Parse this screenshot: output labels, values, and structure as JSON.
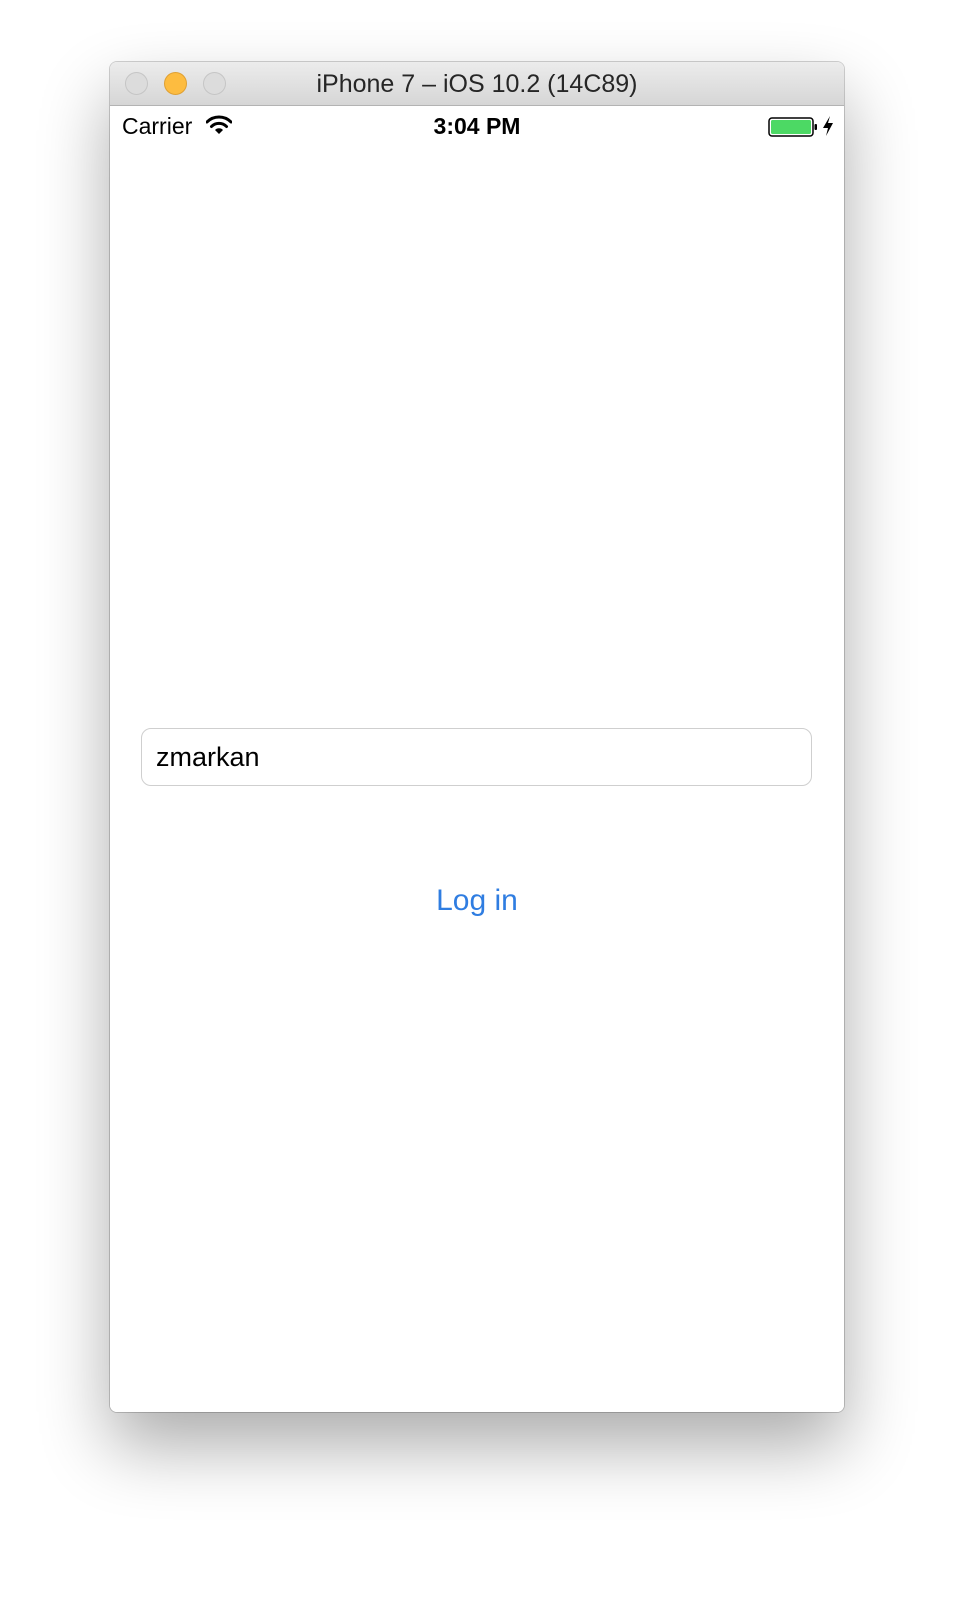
{
  "window": {
    "title": "iPhone 7 – iOS 10.2 (14C89)"
  },
  "statusbar": {
    "carrier": "Carrier",
    "time": "3:04 PM",
    "battery_level": 1.0,
    "charging": true
  },
  "form": {
    "username_value": "zmarkan",
    "login_label": "Log in"
  },
  "colors": {
    "tint": "#2f7de1",
    "battery_fill": "#4cd964",
    "minimize_button": "#fdbc40"
  },
  "icons": [
    "wifi-icon",
    "battery-icon",
    "charging-bolt-icon"
  ]
}
